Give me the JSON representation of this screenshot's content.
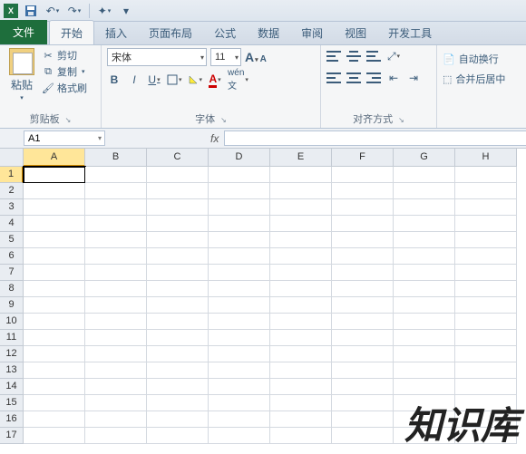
{
  "qat": {
    "app": "X"
  },
  "tabs": {
    "file": "文件",
    "items": [
      "开始",
      "插入",
      "页面布局",
      "公式",
      "数据",
      "审阅",
      "视图",
      "开发工具"
    ],
    "activeIndex": 0
  },
  "clipboard": {
    "paste": "粘贴",
    "cut": "剪切",
    "copy": "复制",
    "formatPainter": "格式刷",
    "groupLabel": "剪贴板"
  },
  "font": {
    "name": "宋体",
    "size": "11",
    "groupLabel": "字体",
    "bold": "B",
    "italic": "I",
    "underline": "U"
  },
  "align": {
    "groupLabel": "对齐方式",
    "wrap": "自动换行",
    "merge": "合并后居中"
  },
  "namebox": "A1",
  "fx": "fx",
  "columns": [
    "A",
    "B",
    "C",
    "D",
    "E",
    "F",
    "G",
    "H"
  ],
  "rows": [
    "1",
    "2",
    "3",
    "4",
    "5",
    "6",
    "7",
    "8",
    "9",
    "10",
    "11",
    "12",
    "13",
    "14",
    "15",
    "16",
    "17"
  ],
  "activeCell": {
    "col": 0,
    "row": 0
  },
  "watermark": "知识库"
}
